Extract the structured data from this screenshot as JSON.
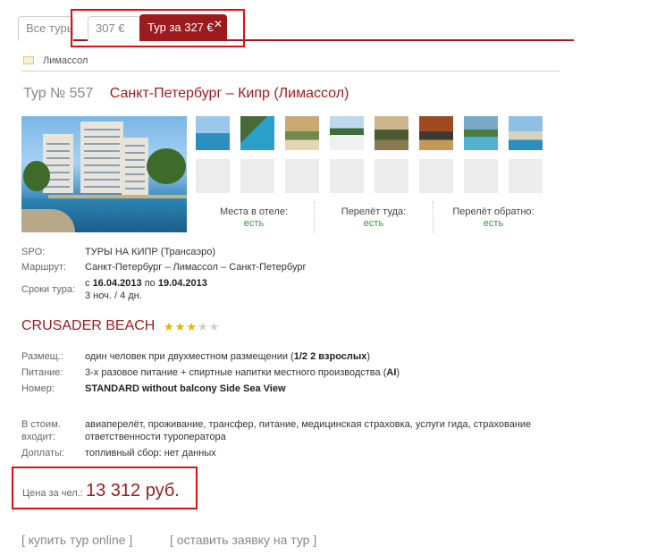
{
  "tabs": {
    "all": "Все туры",
    "t307": "307 €",
    "active": "Тур за 327 €",
    "close_glyph": "✕"
  },
  "location": {
    "city": "Лимассол"
  },
  "tour": {
    "number": "Тур № 557",
    "route": "Санкт-Петербург – Кипр (Лимассол)"
  },
  "availability": [
    {
      "label": "Места в отеле:",
      "value": "есть"
    },
    {
      "label": "Перелёт туда:",
      "value": "есть"
    },
    {
      "label": "Перелёт обратно:",
      "value": "есть"
    }
  ],
  "details": {
    "spo_label": "SPO:",
    "spo_value": "ТУРЫ НА КИПР (Трансаэро)",
    "route_label": "Маршрут:",
    "route_value": "Санкт-Петербург – Лимассол – Санкт-Петербург",
    "dates_label": "Сроки тура:",
    "dates_from_prefix": "с",
    "date_from": "16.04.2013",
    "dates_to_prefix": "по",
    "date_to": "19.04.2013",
    "duration": "3 ноч. / 4 дн."
  },
  "hotel": {
    "name": "CRUSADER BEACH",
    "stars_filled": 3,
    "stars_total": 5
  },
  "room": {
    "placement_label": "Размещ.:",
    "placement_value": "один человек при двухместном размещении",
    "placement_extra": "1/2 2 взрослых",
    "food_label": "Питание:",
    "food_value": "3-х разовое питание + спиртные напитки местного производства",
    "food_code": "AI",
    "room_label": "Номер:",
    "room_value": "STANDARD without balcony Side Sea View"
  },
  "included": {
    "label_line1": "В стоим.",
    "label_line2": "входит:",
    "value_line1": "авиаперелёт, проживание, трансфер, питание, медицинская страховка, услуги гида, страхование",
    "value_line2": "ответственности туроператора",
    "extra_label": "Доплаты:",
    "extra_value": "топливный сбор: нет данных"
  },
  "price": {
    "label": "Цена за чел.:",
    "value": "13 312 руб."
  },
  "actions": {
    "buy": "[ купить тур online ]",
    "request": "[ оставить заявку на тур ]"
  },
  "colors": {
    "accent": "#9c1b1f",
    "available": "#2e9a2e",
    "highlight_box": "#e01010"
  }
}
